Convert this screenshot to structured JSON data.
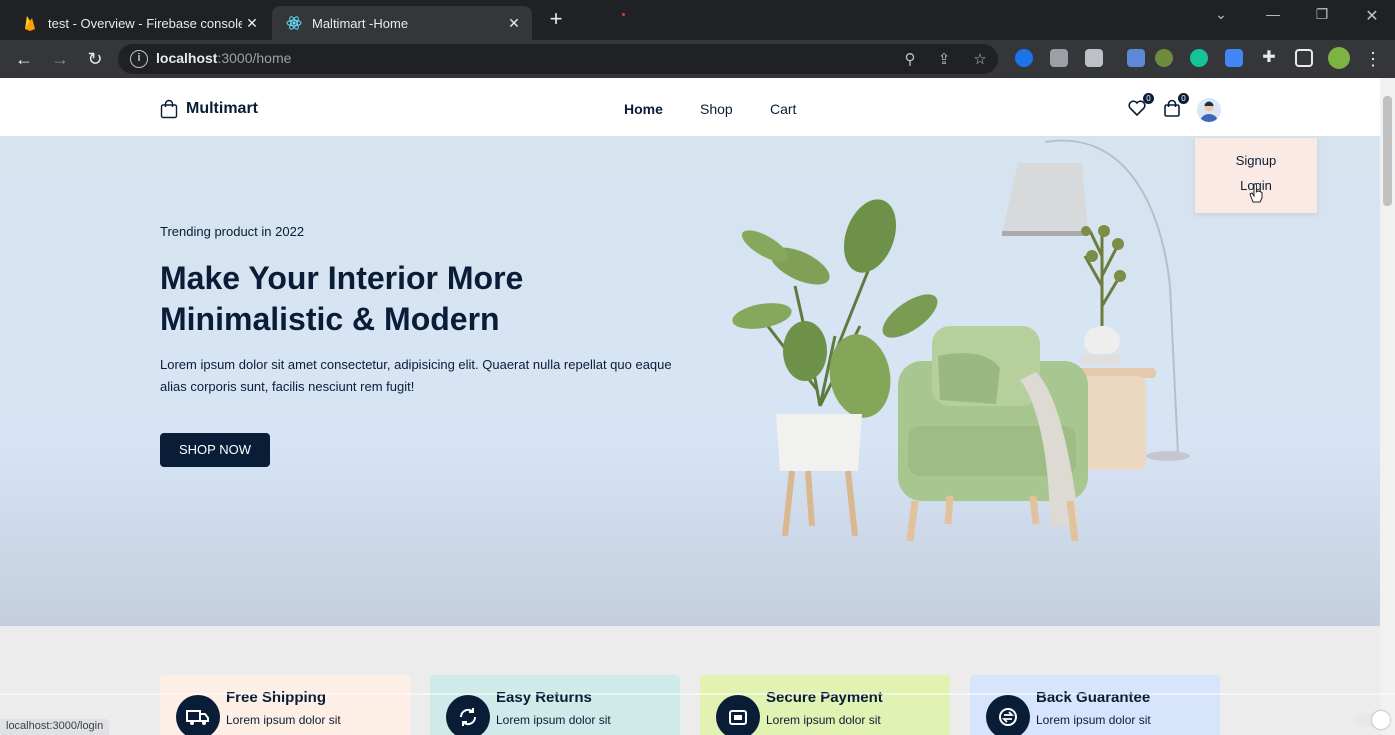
{
  "browser": {
    "tabs": [
      {
        "title": "test - Overview - Firebase console",
        "close_label": "✕"
      },
      {
        "title": "Maltimart -Home",
        "close_label": "✕"
      }
    ],
    "new_tab_label": "+",
    "url_host": "localhost",
    "url_path": ":3000/home",
    "status_url": "localhost:3000/login"
  },
  "header": {
    "brand": "Multimart",
    "nav": [
      {
        "label": "Home",
        "active": true
      },
      {
        "label": "Shop",
        "active": false
      },
      {
        "label": "Cart",
        "active": false
      }
    ],
    "fav_count": "0",
    "cart_count": "0"
  },
  "profile_menu": {
    "items": [
      "Signup",
      "Login"
    ]
  },
  "hero": {
    "subtitle": "Trending product in 2022",
    "title": "Make Your Interior More Minimalistic & Modern",
    "description": "Lorem ipsum dolor sit amet consectetur, adipisicing elit. Quaerat nulla repellat quo eaque alias corporis sunt, facilis nesciunt rem fugit!",
    "button_label": "SHOP NOW"
  },
  "services": [
    {
      "title": "Free Shipping",
      "desc": "Lorem ipsum dolor sit",
      "color": "#fdefe6",
      "icon": "truck-icon"
    },
    {
      "title": "Easy Returns",
      "desc": "Lorem ipsum dolor sit",
      "color": "#ceebe9",
      "icon": "refresh-icon"
    },
    {
      "title": "Secure Payment",
      "desc": "Lorem ipsum dolor sit",
      "color": "#e2f2b2",
      "icon": "secure-icon"
    },
    {
      "title": "Back Guarantee",
      "desc": "Lorem ipsum dolor sit",
      "color": "#d6e5fb",
      "icon": "exchange-icon"
    }
  ],
  "colors": {
    "primary": "#0a1d37",
    "hero_bg": "#d6e4f0"
  }
}
